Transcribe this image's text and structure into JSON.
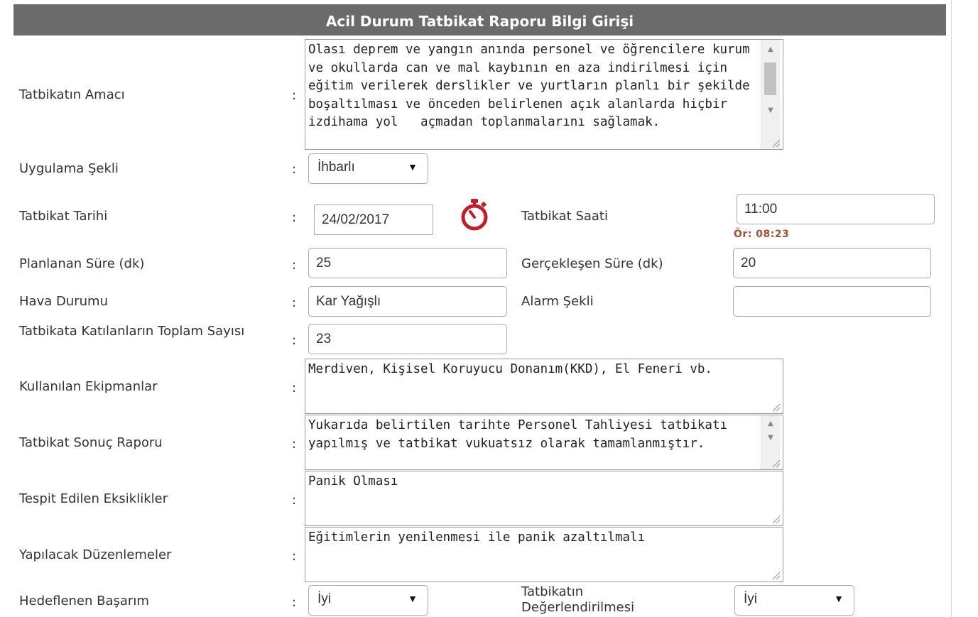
{
  "form": {
    "title": "Acil Durum Tatbikat Raporu Bilgi Girişi",
    "separator": ":",
    "purpose": {
      "label": "Tatbikatın Amacı",
      "value": "Olası deprem ve yangın anında personel ve öğrencilere kurum ve okullarda can ve mal kaybının en aza indirilmesi için eğitim verilerek derslikler ve yurtların planlı bir şekilde  boşaltılması ve önceden belirlenen açık alanlarda hiçbir izdihama yol   açmadan toplanmalarını sağlamak."
    },
    "application_type": {
      "label": "Uygulama Şekli",
      "value": "İhbarlı"
    },
    "drill_date": {
      "label": "Tatbikat Tarihi",
      "value": "24/02/2017",
      "icon": "stopwatch-icon"
    },
    "drill_time": {
      "label": "Tatbikat Saati",
      "value": "11:00",
      "hint": "Ör: 08:23"
    },
    "planned_duration": {
      "label": "Planlanan Süre (dk)",
      "value": "25"
    },
    "actual_duration": {
      "label": "Gerçekleşen Süre (dk)",
      "value": "20"
    },
    "weather": {
      "label": "Hava Durumu",
      "value": "Kar Yağışlı"
    },
    "alarm_type": {
      "label": "Alarm Şekli",
      "value": ""
    },
    "participants": {
      "label": "Tatbikata Katılanların Toplam Sayısı",
      "value": "23"
    },
    "equipment": {
      "label": "Kullanılan Ekipmanlar",
      "value": "Merdiven, Kişisel Koruyucu Donanım(KKD), El Feneri vb."
    },
    "result_report": {
      "label": "Tatbikat Sonuç Raporu",
      "value": "Yukarıda belirtilen tarihte Personel Tahliyesi tatbikatı yapılmış ve tatbikat vukuatsız olarak tamamlanmıştır."
    },
    "deficiencies": {
      "label": "Tespit Edilen Eksiklikler",
      "value": "Panik Olması"
    },
    "improvements": {
      "label": "Yapılacak Düzenlemeler",
      "value": "Eğitimlerin yenilenmesi ile panik azaltılmalı"
    },
    "target_success": {
      "label": "Hedeflenen Başarım",
      "value": "İyi"
    },
    "evaluation": {
      "label": "Tatbikatın Değerlendirilmesi",
      "value": "İyi"
    }
  },
  "colors": {
    "header_bg": "#6b6b6b",
    "icon_red": "#c0202a",
    "hint": "#a0522d"
  }
}
